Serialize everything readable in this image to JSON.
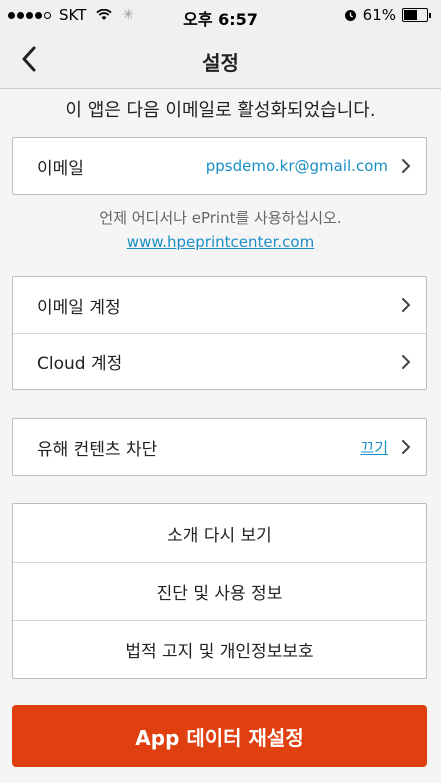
{
  "status_bar": {
    "carrier": "SKT",
    "time": "오후 6:57",
    "battery": "61%",
    "battery_level": 0.61
  },
  "nav": {
    "title": "설정"
  },
  "intro": "이 앱은 다음 이메일로 활성화되었습니다.",
  "email_row": {
    "label": "이메일",
    "value": "ppsdemo.kr@gmail.com"
  },
  "info": {
    "text": "언제 어디서나 ePrint를 사용하십시오.",
    "link": "www.hpeprintcenter.com"
  },
  "accounts": [
    {
      "label": "이메일 계정"
    },
    {
      "label": "Cloud 계정"
    }
  ],
  "content_block": {
    "label": "유해 컨텐츠 차단",
    "value": "끄기"
  },
  "misc": [
    {
      "label": "소개 다시 보기"
    },
    {
      "label": "진단 및 사용 정보"
    },
    {
      "label": "법적 고지 및 개인정보보호"
    }
  ],
  "reset_button": "App 데이터 재설정",
  "colors": {
    "accent": "#1a8fc7",
    "reset": "#e0400f"
  }
}
